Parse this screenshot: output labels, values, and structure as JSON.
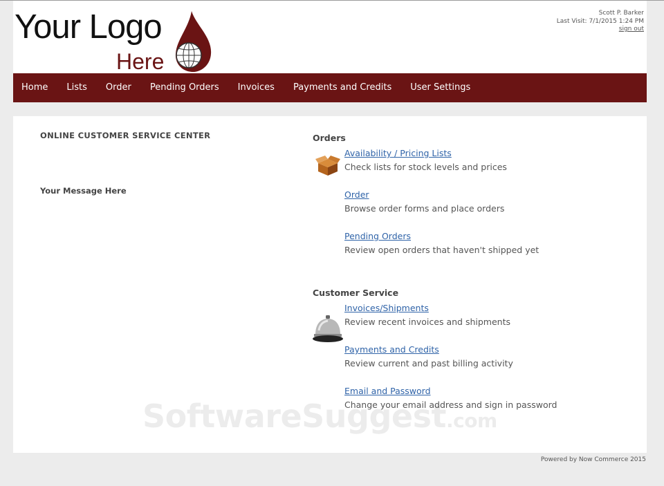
{
  "logo": {
    "line1": "Your Logo",
    "line2": "Here",
    "mark_icon": "globe-drop-icon"
  },
  "user": {
    "name": "Scott P. Barker",
    "last_visit": "Last Visit: 7/1/2015 1:24 PM",
    "sign_out": "sign out"
  },
  "nav": {
    "items": [
      "Home",
      "Lists",
      "Order",
      "Pending Orders",
      "Invoices",
      "Payments and Credits",
      "User Settings"
    ]
  },
  "left": {
    "title": "ONLINE CUSTOMER SERVICE CENTER",
    "message": "Your Message Here"
  },
  "orders": {
    "heading": "Orders",
    "icon": "box-icon",
    "links": [
      {
        "label": "Availability / Pricing Lists",
        "desc": "Check lists for stock levels and prices"
      },
      {
        "label": "Order",
        "desc": "Browse order forms and place orders"
      },
      {
        "label": "Pending Orders",
        "desc": "Review open orders that haven't shipped yet"
      }
    ]
  },
  "service": {
    "heading": "Customer Service",
    "icon": "service-bell-icon",
    "links": [
      {
        "label": "Invoices/Shipments",
        "desc": "Review recent invoices and shipments"
      },
      {
        "label": "Payments and Credits",
        "desc": "Review current and past billing activity"
      },
      {
        "label": "Email and Password",
        "desc": "Change your email address and sign in password"
      }
    ]
  },
  "watermark": {
    "main": "SoftwareSuggest",
    "suffix": ".com"
  },
  "footer": "Powered by Now Commerce 2015",
  "colors": {
    "brand": "#6a1414",
    "link": "#2f63a8",
    "background": "#ececec"
  }
}
